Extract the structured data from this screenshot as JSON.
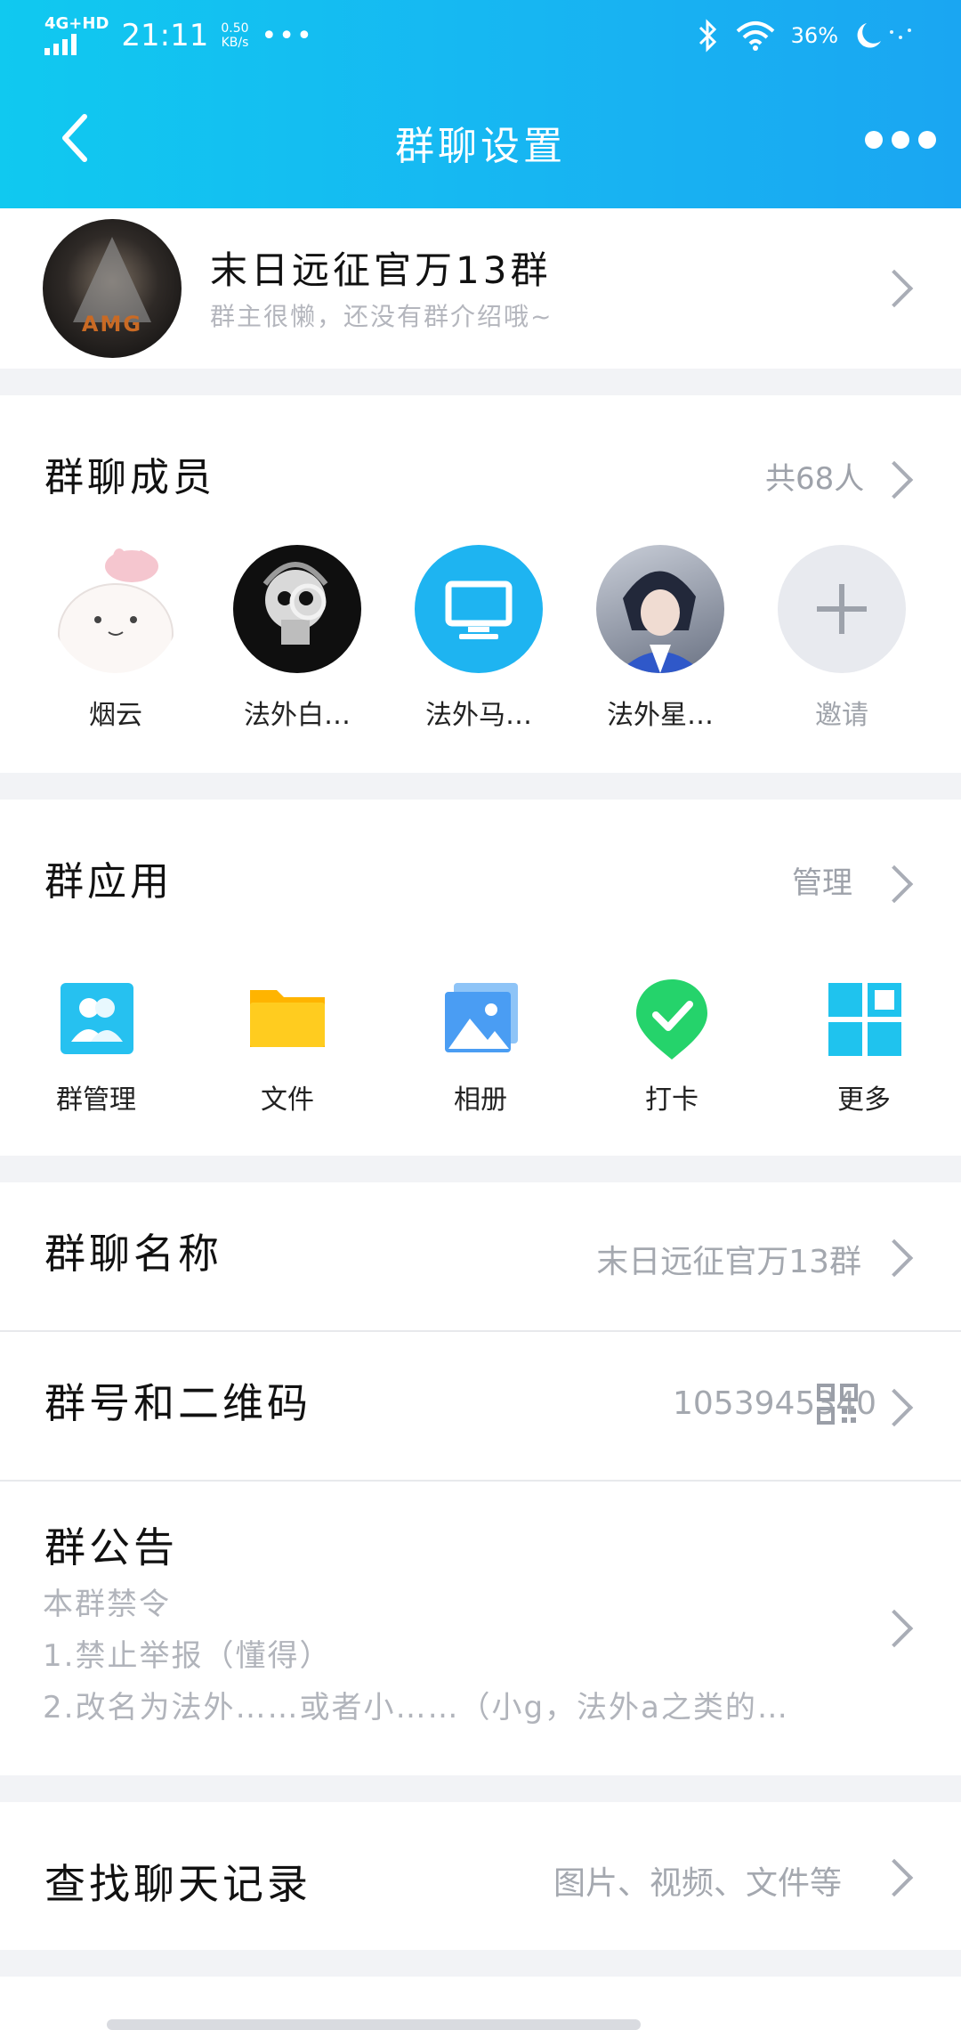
{
  "status_bar": {
    "network": "4G+HD",
    "time": "21:11",
    "speed_value": "0.50",
    "speed_unit": "KB/s",
    "dots": "•••",
    "battery": "36%"
  },
  "header": {
    "title": "群聊设置"
  },
  "group": {
    "name": "末日远征官万13群",
    "description": "群主很懒，还没有群介绍哦~",
    "avatar_text": "AMG"
  },
  "members": {
    "title": "群聊成员",
    "count": "共68人",
    "items": [
      {
        "name": "烟云"
      },
      {
        "name": "法外白…"
      },
      {
        "name": "法外马…"
      },
      {
        "name": "法外星…"
      }
    ],
    "invite_label": "邀请"
  },
  "apps": {
    "title": "群应用",
    "manage": "管理",
    "items": [
      {
        "label": "群管理",
        "icon": "group-manage-icon",
        "color": "#26c1f0"
      },
      {
        "label": "文件",
        "icon": "folder-icon",
        "color": "#ffc61a"
      },
      {
        "label": "相册",
        "icon": "photo-album-icon",
        "color": "#4a9df3"
      },
      {
        "label": "打卡",
        "icon": "check-in-icon",
        "color": "#25d36b"
      },
      {
        "label": "更多",
        "icon": "more-apps-icon",
        "color": "#1fc3ee"
      }
    ]
  },
  "settings": {
    "group_name_label": "群聊名称",
    "group_name_value": "末日远征官万13群",
    "group_number_label": "群号和二维码",
    "group_number_value": "1053945340",
    "notice_label": "群公告",
    "notice_lines": [
      "本群禁令",
      "1.禁止举报（懂得）",
      "2.改名为法外……或者小……（小g，法外a之类的…"
    ],
    "search_label": "查找聊天记录",
    "search_value": "图片、视频、文件等"
  },
  "colors": {
    "header_start": "#10c9f0",
    "header_end": "#1aa6f2",
    "secondary_text": "#a4a8af"
  }
}
